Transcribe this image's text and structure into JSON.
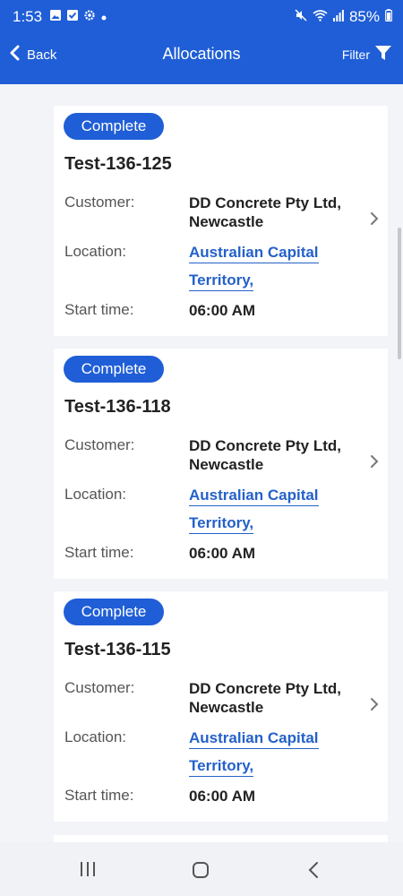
{
  "status_bar": {
    "time": "1:53",
    "battery": "85%",
    "icons": [
      "image-icon",
      "check-box-icon",
      "settings-icon",
      "dot-icon",
      "mute-icon",
      "wifi-icon",
      "signal-icon",
      "battery-icon"
    ]
  },
  "header": {
    "back_label": "Back",
    "title": "Allocations",
    "filter_label": "Filter"
  },
  "labels": {
    "customer": "Customer:",
    "location": "Location:",
    "start_time": "Start time:"
  },
  "allocations": [
    {
      "status": "Complete",
      "job": "Test-136-125",
      "customer_line1": "DD Concrete Pty Ltd,",
      "customer_line2": "Newcastle",
      "location_line1": "Australian Capital",
      "location_line2": "Territory,",
      "start_time": "06:00 AM"
    },
    {
      "status": "Complete",
      "job": "Test-136-118",
      "customer_line1": "DD Concrete Pty Ltd,",
      "customer_line2": "Newcastle",
      "location_line1": "Australian Capital",
      "location_line2": "Territory,",
      "start_time": "06:00 AM"
    },
    {
      "status": "Complete",
      "job": "Test-136-115",
      "customer_line1": "DD Concrete Pty Ltd,",
      "customer_line2": "Newcastle",
      "location_line1": "Australian Capital",
      "location_line2": "Territory,",
      "start_time": "06:00 AM"
    }
  ],
  "colors": {
    "brand": "#1f5ed6",
    "link": "#2461c9",
    "background": "#f3f4f8"
  }
}
